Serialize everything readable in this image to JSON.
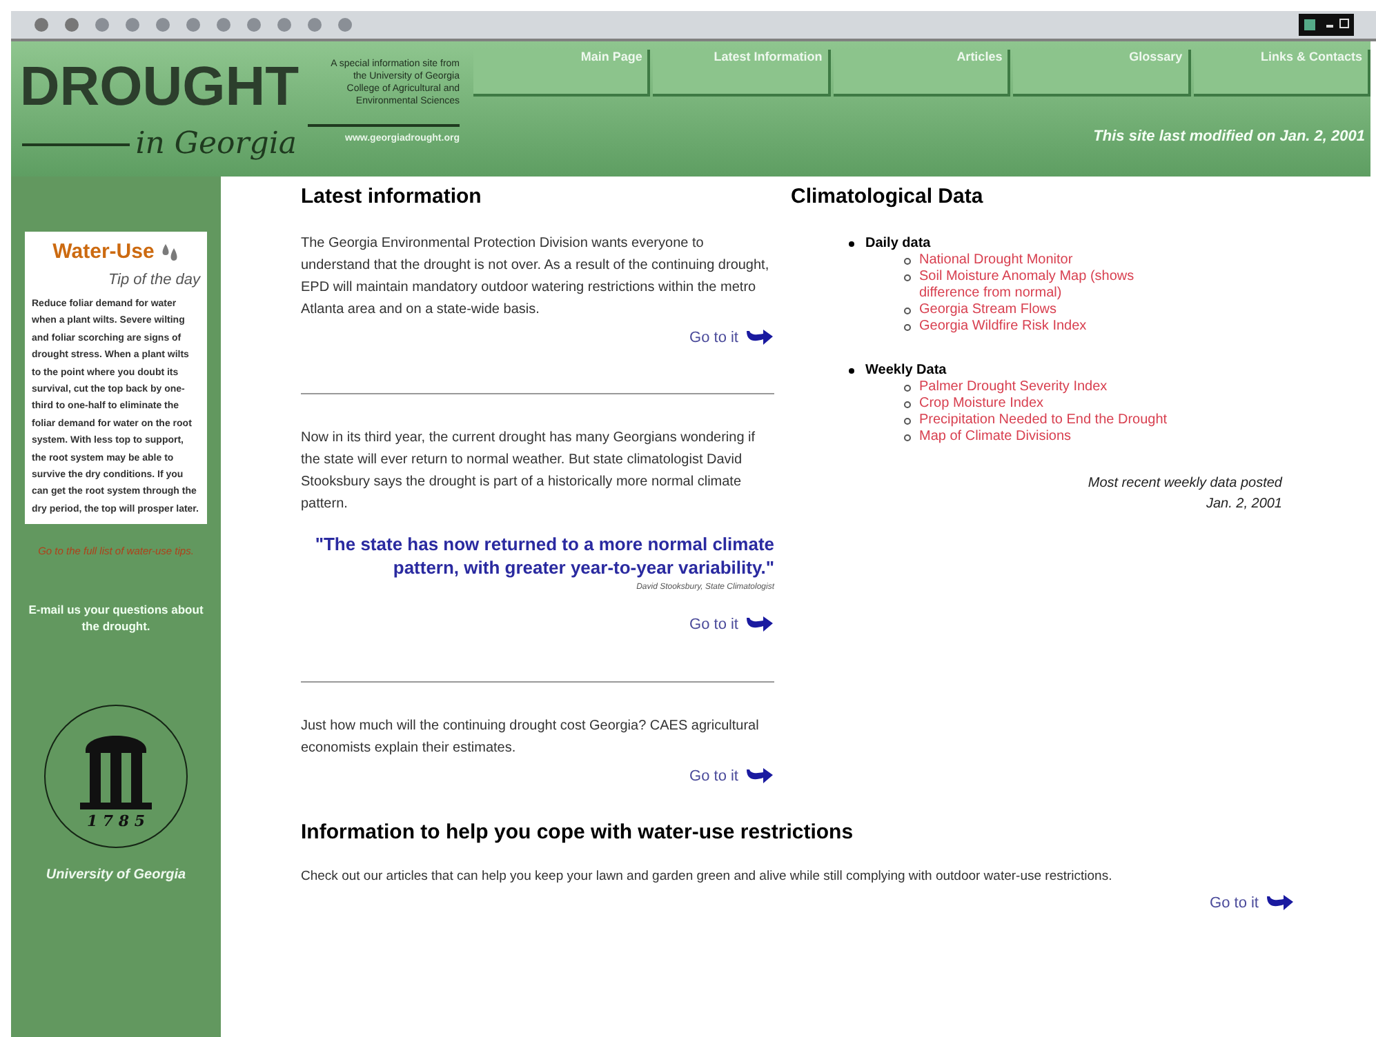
{
  "header": {
    "logo": "DROUGHT",
    "logo_subtitle": "in Georgia",
    "blurb": "A special information site from the University of Georgia College of Agricultural and Environmental Sciences",
    "url": "www.georgiadrought.org",
    "nav": [
      {
        "label": "Main Page"
      },
      {
        "label": "Latest Information"
      },
      {
        "label": "Articles"
      },
      {
        "label": "Glossary"
      },
      {
        "label": "Links & Contacts"
      }
    ],
    "modified": "This site last modified on Jan. 2, 2001"
  },
  "sidebar": {
    "tip_title": "Water-Use",
    "tip_subtitle": "Tip of the day",
    "tip_text": "Reduce foliar demand for water when a plant wilts. Severe wilting and foliar scorching are signs of drought stress. When a plant wilts to the point where you doubt its survival, cut the top back by one-third to one-half to eliminate the foliar demand for water on the root system. With less top to support, the root system may be able to survive the dry conditions. If you can get the root system through the dry period, the top will prosper later.",
    "tips_link": "Go to the full list of water-use tips.",
    "email_link": "E-mail us your questions about the drought.",
    "seal_year": "1 7 8 5",
    "university": "University of Georgia"
  },
  "latest": {
    "heading": "Latest information",
    "items": [
      {
        "text": "The Georgia Environmental Protection Division wants everyone to understand that the drought is not over. As a result of the continuing drought, EPD will maintain mandatory outdoor watering restrictions within the metro Atlanta area and on a state-wide basis.",
        "link": "Go to it"
      },
      {
        "text": "Now in its third year, the current drought has many Georgians wondering if the state will ever return to normal weather. But state climatologist David Stooksbury says the drought is part of a historically more normal climate pattern.",
        "quote": "\"The state has now returned to a more normal climate pattern, with greater year-to-year variability.\"",
        "attribution": "David Stooksbury, State Climatologist",
        "link": "Go to it"
      },
      {
        "text": "Just how much will the continuing drought cost Georgia? CAES agricultural economists explain their estimates.",
        "link": "Go to it"
      }
    ]
  },
  "climate": {
    "heading": "Climatological Data",
    "groups": [
      {
        "label": "Daily data",
        "links": [
          "National Drought Monitor",
          "Soil Moisture Anomaly Map (shows difference from normal)",
          "Georgia Stream Flows",
          "Georgia Wildfire Risk Index"
        ]
      },
      {
        "label": "Weekly Data",
        "links": [
          "Palmer Drought Severity Index",
          "Crop Moisture Index",
          "Precipitation Needed to End the Drought",
          "Map of Climate Divisions"
        ]
      }
    ],
    "posted": "Most recent weekly data posted",
    "posted_date": "Jan. 2, 2001"
  },
  "coping": {
    "heading": "Information to help you cope with water-use restrictions",
    "text": "Check out our articles that can help you keep your lawn and garden green and alive while still complying with outdoor water-use restrictions.",
    "link": "Go to it"
  }
}
